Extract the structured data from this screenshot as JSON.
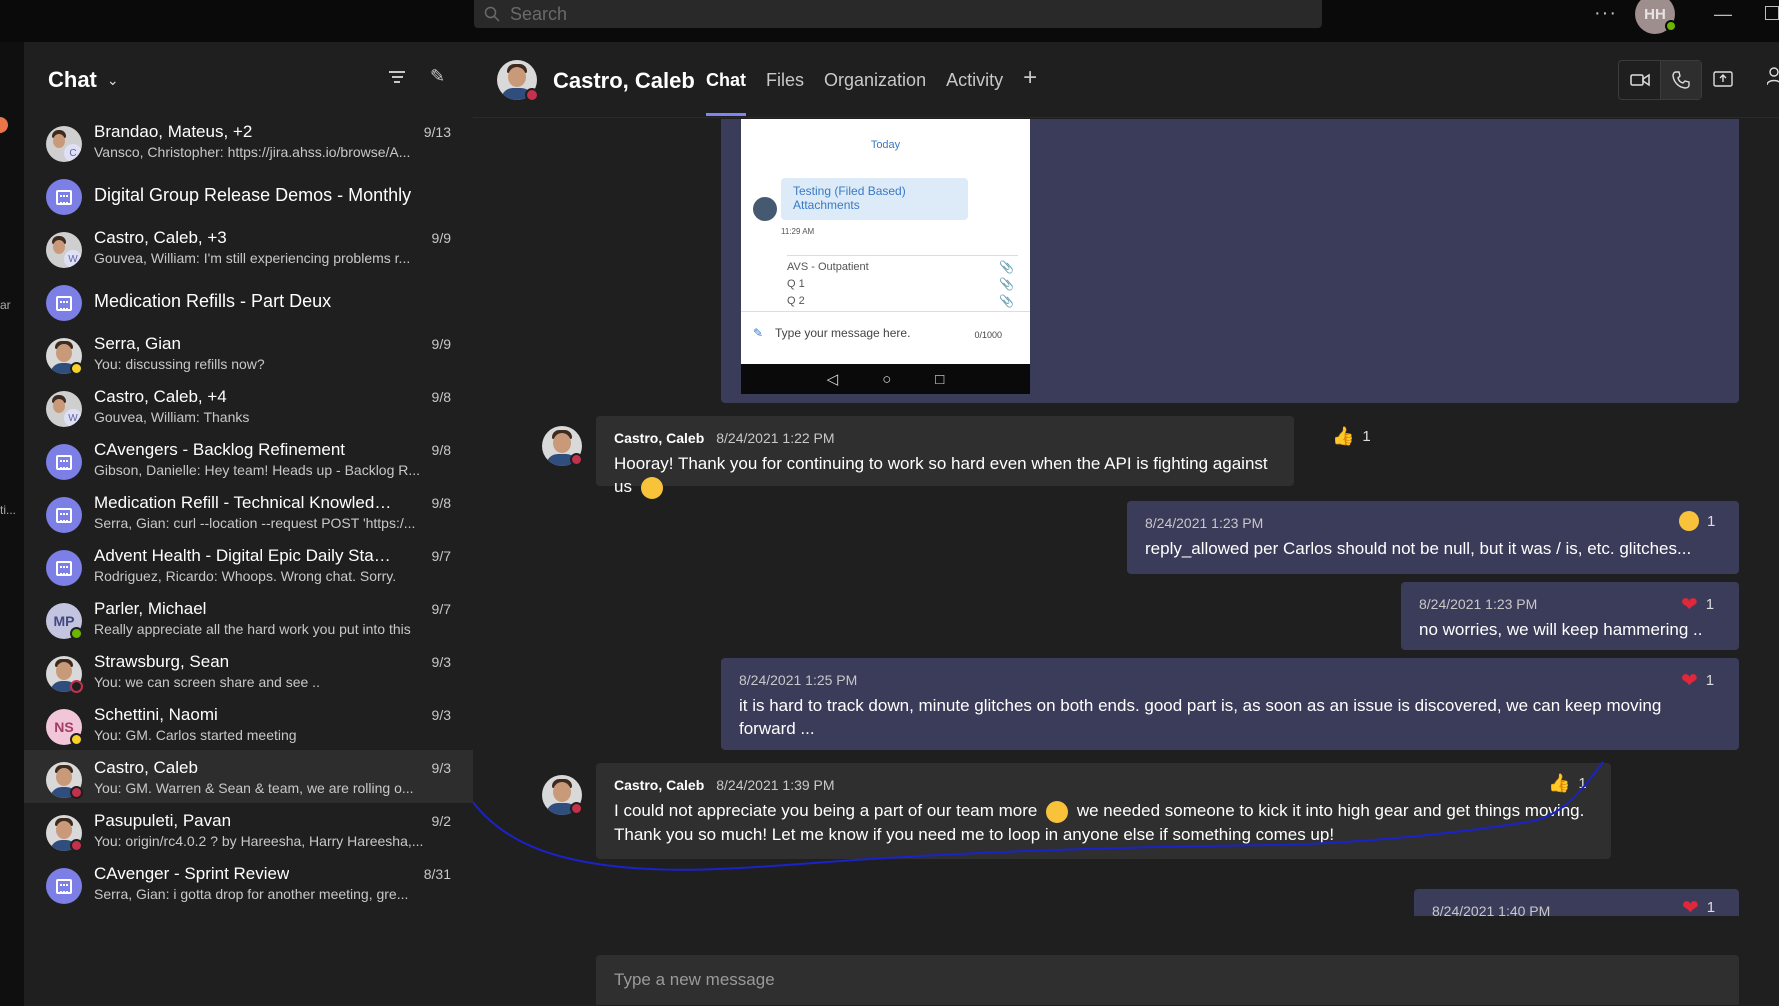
{
  "topbar": {
    "search_placeholder": "Search",
    "more_label": "···",
    "user_initials": "HH"
  },
  "rail": {
    "label_1": "ar",
    "label_2": "ti..."
  },
  "left": {
    "title": "Chat"
  },
  "chats": [
    {
      "name": "Brandao, Mateus, +2",
      "date": "9/13",
      "preview": "Vansco, Christopher: https://jira.ahss.io/browse/A...",
      "avatar": "group-c"
    },
    {
      "name": "Digital Group Release Demos - Monthly",
      "date": "",
      "preview": "",
      "avatar": "meeting"
    },
    {
      "name": "Castro, Caleb, +3",
      "date": "9/9",
      "preview": "Gouvea, William: I'm still experiencing problems r...",
      "avatar": "group-w"
    },
    {
      "name": "Medication Refills - Part Deux",
      "date": "",
      "preview": "",
      "avatar": "meeting"
    },
    {
      "name": "Serra, Gian",
      "date": "9/9",
      "preview": "You: discussing refills now?",
      "avatar": "photo",
      "status": "away"
    },
    {
      "name": "Castro, Caleb, +4",
      "date": "9/8",
      "preview": "Gouvea, William: Thanks",
      "avatar": "group-w"
    },
    {
      "name": "CAvengers - Backlog Refinement",
      "date": "9/8",
      "preview": "Gibson, Danielle: Hey team! Heads up - Backlog R...",
      "avatar": "meeting"
    },
    {
      "name": "Medication Refill - Technical Knowledge...",
      "date": "9/8",
      "preview": "Serra, Gian: curl --location --request POST 'https:/...",
      "avatar": "meeting"
    },
    {
      "name": "Advent Health - Digital Epic Daily Stand...",
      "date": "9/7",
      "preview": "Rodriguez, Ricardo: Whoops. Wrong chat. Sorry.",
      "avatar": "meeting"
    },
    {
      "name": "Parler, Michael",
      "date": "9/7",
      "preview": "Really appreciate all the hard work you put into this",
      "avatar": "MP",
      "status": "ok"
    },
    {
      "name": "Strawsburg, Sean",
      "date": "9/3",
      "preview": "You: we can screen share and see ..",
      "avatar": "photo",
      "status": "off"
    },
    {
      "name": "Schettini, Naomi",
      "date": "9/3",
      "preview": "You: GM. Carlos started meeting",
      "avatar": "NS",
      "status": "away"
    },
    {
      "name": "Castro, Caleb",
      "date": "9/3",
      "preview": "You: GM. Warren & Sean & team, we are rolling o...",
      "avatar": "photo",
      "status": "dnd",
      "selected": true
    },
    {
      "name": "Pasupuleti, Pavan",
      "date": "9/2",
      "preview": "You: origin/rc4.0.2 ? by Hareesha, Harry Hareesha,...",
      "avatar": "photo",
      "status": "dnd"
    },
    {
      "name": "CAvenger - Sprint Review",
      "date": "8/31",
      "preview": "Serra, Gian: i gotta drop for another meeting, gre...",
      "avatar": "meeting"
    }
  ],
  "header": {
    "name": "Castro, Caleb",
    "tabs": [
      "Chat",
      "Files",
      "Organization",
      "Activity"
    ]
  },
  "screenshot": {
    "today": "Today",
    "bubble": "Testing (Filed Based) Attachments",
    "time": "11:29 AM",
    "rows": [
      "AVS - Outpatient",
      "Q 1",
      "Q 2"
    ],
    "input_placeholder": "Type your message here.",
    "counter": "0/1000"
  },
  "messages": [
    {
      "author": "Castro, Caleb",
      "time": "8/24/2021 1:22 PM",
      "text": "Hooray! Thank you for continuing to work so hard even when the API is fighting against us",
      "reaction_count": "1",
      "reaction": "like-icon"
    },
    {
      "author": "",
      "time": "8/24/2021 1:23 PM",
      "text": "reply_allowed per Carlos should not be null, but it was / is, etc. glitches...",
      "reaction_count": "1",
      "reaction": "sad-icon"
    },
    {
      "author": "",
      "time": "8/24/2021 1:23 PM",
      "text": "no worries, we will keep hammering ..",
      "reaction_count": "1",
      "reaction": "heart-icon"
    },
    {
      "author": "",
      "time": "8/24/2021 1:25 PM",
      "text": "it is hard to track down, minute glitches on both ends. good part is, as soon as an issue is discovered, we can keep moving forward ...",
      "reaction_count": "1",
      "reaction": "heart-icon"
    },
    {
      "author": "Castro, Caleb",
      "time": "8/24/2021 1:39 PM",
      "text_a": "I could not appreciate you being a part of our team more",
      "text_b": "we needed someone to kick it into high gear and get things moving. Thank you so much! Let me know if you need me to loop in anyone else if something comes up!",
      "reaction_count": "1",
      "reaction": "like-icon"
    },
    {
      "author": "",
      "time": "8/24/2021 1:40 PM",
      "text": "",
      "reaction_count": "1",
      "reaction": "heart-icon"
    }
  ],
  "composer": {
    "placeholder": "Type a new message"
  },
  "colors": {
    "accent": "#7f85f5",
    "outgoing": "#3b3b5a",
    "incoming": "#2f2f2f",
    "annotation": "#1a22c9"
  }
}
